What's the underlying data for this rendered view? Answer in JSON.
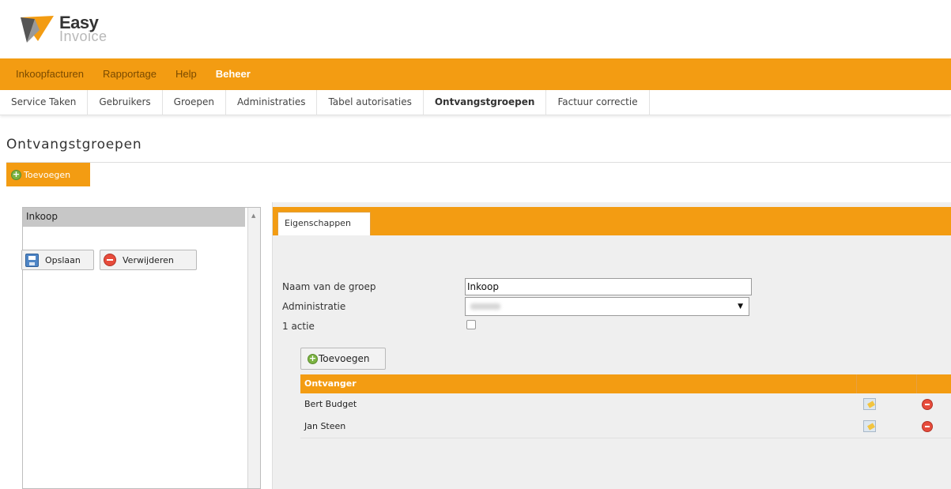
{
  "app": {
    "logo_text": "Easy",
    "logo_subtext": "Invoice"
  },
  "main_nav": {
    "items": [
      "Inkoopfacturen",
      "Rapportage",
      "Help",
      "Beheer"
    ],
    "active": "Beheer"
  },
  "sub_nav": {
    "items": [
      "Service Taken",
      "Gebruikers",
      "Groepen",
      "Administraties",
      "Tabel autorisaties",
      "Ontvangstgroepen",
      "Factuur correctie"
    ],
    "active": "Ontvangstgroepen"
  },
  "page": {
    "title": "Ontvangstgroepen",
    "add_button": "Toevoegen"
  },
  "group_list": {
    "items": [
      "Inkoop"
    ],
    "selected": "Inkoop"
  },
  "detail": {
    "tab_label": "Eigenschappen",
    "save_label": "Opslaan",
    "delete_label": "Verwijderen",
    "fields": {
      "name_label": "Naam van de groep",
      "name_value": "Inkoop",
      "admin_label": "Administratie",
      "actie_label": "1 actie",
      "actie_checked": false
    },
    "add_recipient_label": "Toevoegen",
    "table": {
      "header": "Ontvanger",
      "rows": [
        {
          "name": "Bert Budget"
        },
        {
          "name": "Jan Steen"
        }
      ]
    }
  },
  "colors": {
    "accent": "#f39c12",
    "nav_text": "#7a4a00",
    "panel_bg": "#efefef"
  }
}
